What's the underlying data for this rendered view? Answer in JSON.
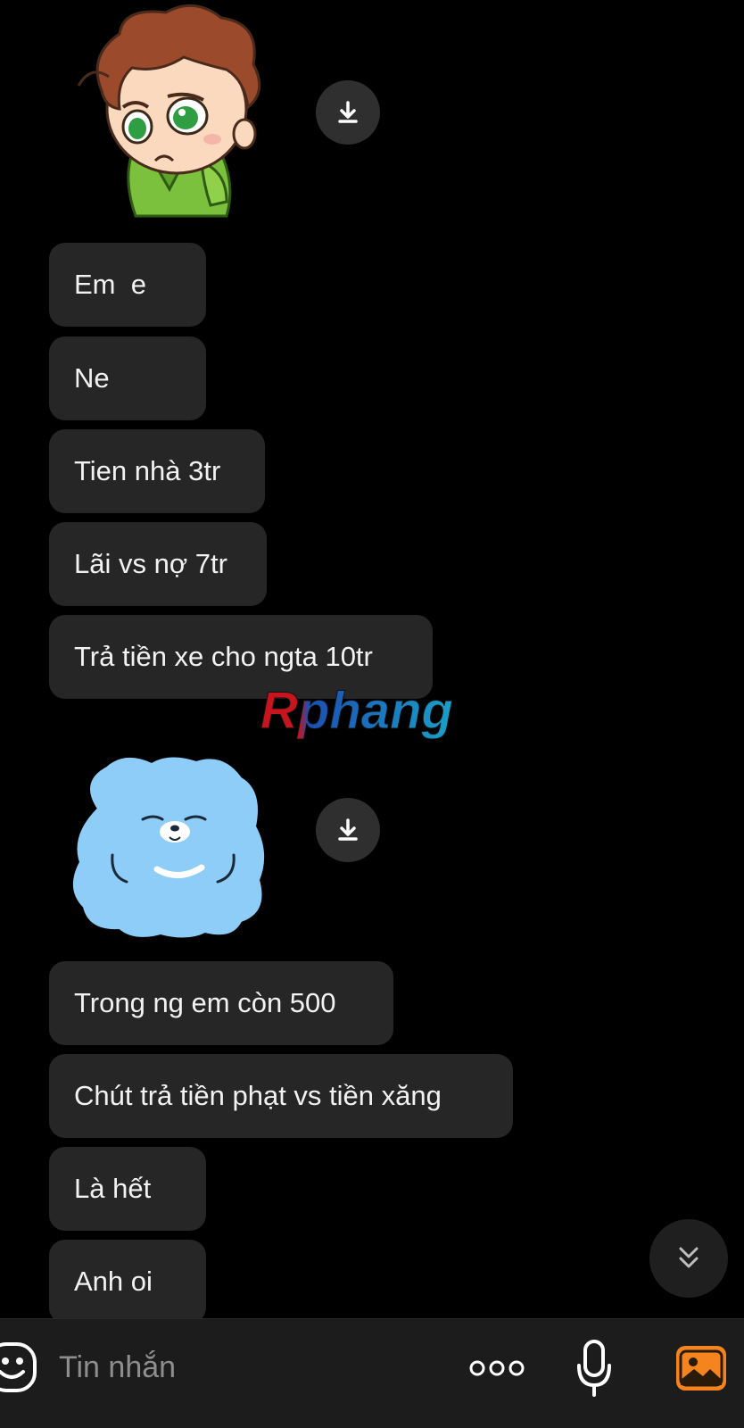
{
  "conversation": {
    "messages": [
      {
        "text": "Em  e"
      },
      {
        "text": "Ne"
      },
      {
        "text": "Tien nhà 3tr"
      },
      {
        "text": "Lãi vs nợ 7tr"
      },
      {
        "text": "Trả tiền xe cho ngta 10tr"
      },
      {
        "text": "Trong ng em còn 500"
      },
      {
        "text": "Chút trả tiền phạt vs tiền xăng"
      },
      {
        "text": "Là hết"
      },
      {
        "text": "Anh oi"
      }
    ],
    "stickers": [
      {
        "icon": "sad-boy-sticker"
      },
      {
        "icon": "sleepy-blue-bear-sticker"
      }
    ]
  },
  "watermark": {
    "text": "Rphang",
    "colors": [
      "#c8151d",
      "#1b4fb3",
      "#1aa0c8"
    ]
  },
  "composer": {
    "placeholder": "Tin nhắn",
    "icons": [
      "emoji-icon",
      "more-options-icon",
      "microphone-icon",
      "image-icon"
    ],
    "accent": "#f5841f"
  }
}
